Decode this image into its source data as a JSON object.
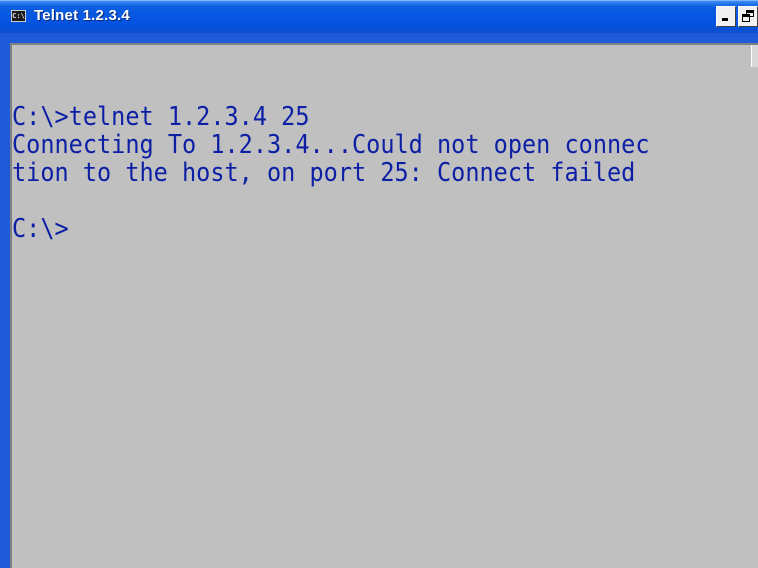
{
  "window": {
    "title": "Telnet 1.2.3.4",
    "icon": "cmd-icon",
    "icon_text": "C:\\",
    "colors": {
      "titlebar": "#0554e3",
      "console_bg": "#c0c0c0",
      "console_text": "#0d20a5"
    }
  },
  "console": {
    "lines": [
      "C:\\>telnet 1.2.3.4 25",
      "Connecting To 1.2.3.4...Could not open connec",
      "tion to the host, on port 25: Connect failed",
      "",
      "C:\\>"
    ]
  }
}
